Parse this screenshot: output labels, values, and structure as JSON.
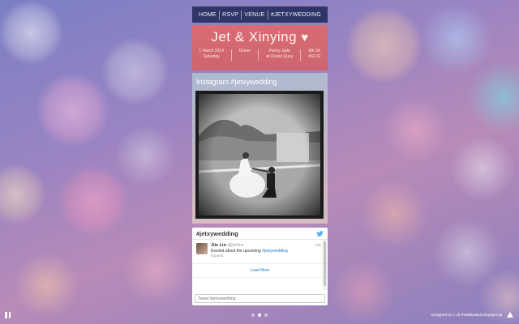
{
  "nav": {
    "items": [
      "HOME",
      "RSVP",
      "VENUE",
      "#JETXYWEDDING"
    ]
  },
  "title_block": {
    "title": "Jet & Xinying",
    "heart": "♥",
    "details": [
      [
        "1 March 2014",
        "Saturday"
      ],
      [
        "Dinner"
      ],
      [
        "Peony Jade",
        "at Clarke Quay"
      ],
      [
        "Blk 3A",
        "#02-02"
      ]
    ]
  },
  "instagram": {
    "title": "Instagram #jetxywedding"
  },
  "twitter_widget": {
    "title": "#jetxywedding",
    "tweet": {
      "name": "Jiie Lin",
      "handle": "@jiieilinn",
      "text_prefix": "Excited about the upcoming ",
      "hashtag": "#jetxywedding",
      "expand": "Expand",
      "time": "19h"
    },
    "load_more": "Load More",
    "tweet_placeholder": "Tweet #jetxywedding"
  },
  "footer": {
    "credit": "Designed by J. @ thedailyadoly.blogspot.sg",
    "dots": 3,
    "active_dot": 1
  },
  "colors": {
    "nav_bg": "#2f3566",
    "title_bg": "#d86c72",
    "twitter_blue": "#2b7bb9"
  }
}
